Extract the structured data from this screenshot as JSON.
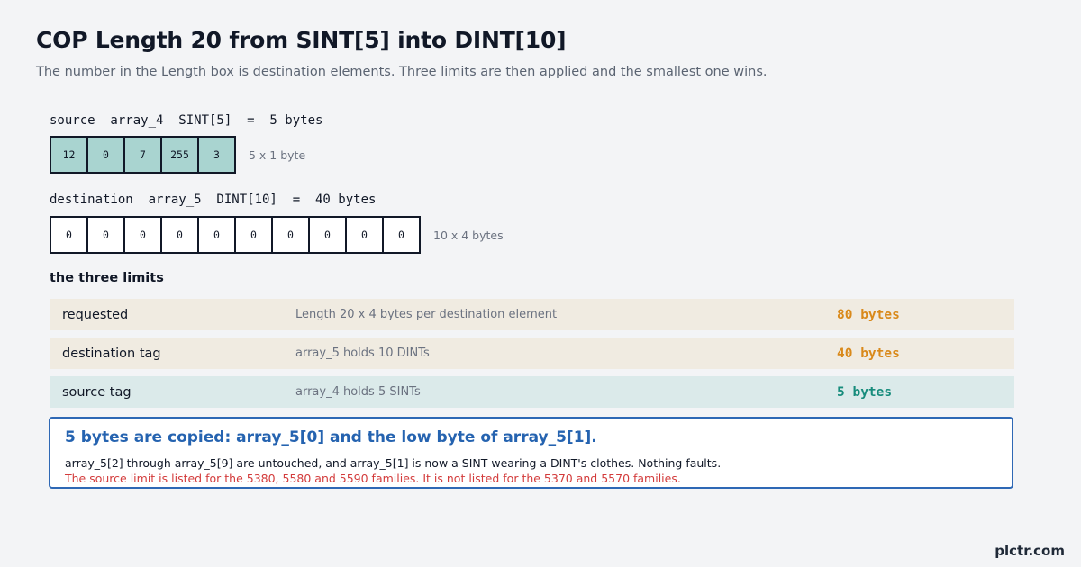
{
  "title": "COP Length 20 from SINT[5] into DINT[10]",
  "subtitle": "The number in the Length box is destination elements. Three limits are then applied and the smallest one wins.",
  "source": {
    "label": "source  array_4  SINT[5]  =  5 bytes",
    "cells": [
      "12",
      "0",
      "7",
      "255",
      "3"
    ],
    "note": "5 x 1 byte"
  },
  "destination": {
    "label": "destination  array_5  DINT[10]  =  40 bytes",
    "cells": [
      "0",
      "0",
      "0",
      "0",
      "0",
      "0",
      "0",
      "0",
      "0",
      "0"
    ],
    "note": "10 x 4 bytes"
  },
  "limits": {
    "title": "the three limits",
    "rows": [
      {
        "name": "requested",
        "desc": "Length 20 x 4 bytes per destination element",
        "value": "80 bytes"
      },
      {
        "name": "destination tag",
        "desc": "array_5 holds 10 DINTs",
        "value": "40 bytes"
      },
      {
        "name": "source tag",
        "desc": "array_4 holds 5 SINTs",
        "value": "5 bytes"
      }
    ]
  },
  "result": {
    "headline": "5 bytes are copied: array_5[0] and the low byte of array_5[1].",
    "body": "array_5[2] through array_5[9] are untouched, and array_5[1] is now a SINT wearing a DINT's clothes. Nothing faults.",
    "warning": "The source limit is listed for the 5380, 5580 and 5590 families. It is not listed for the 5370 and 5570 families."
  },
  "brand": "plctr.com",
  "colors": {
    "source_cell": "#a9d4d0",
    "limit_beige": "#f0ebe1",
    "limit_teal": "#dbeaea",
    "value_orange": "#d9891a",
    "value_teal": "#178c7c",
    "result_border": "#2e68b5",
    "warning_red": "#d33b3b"
  }
}
